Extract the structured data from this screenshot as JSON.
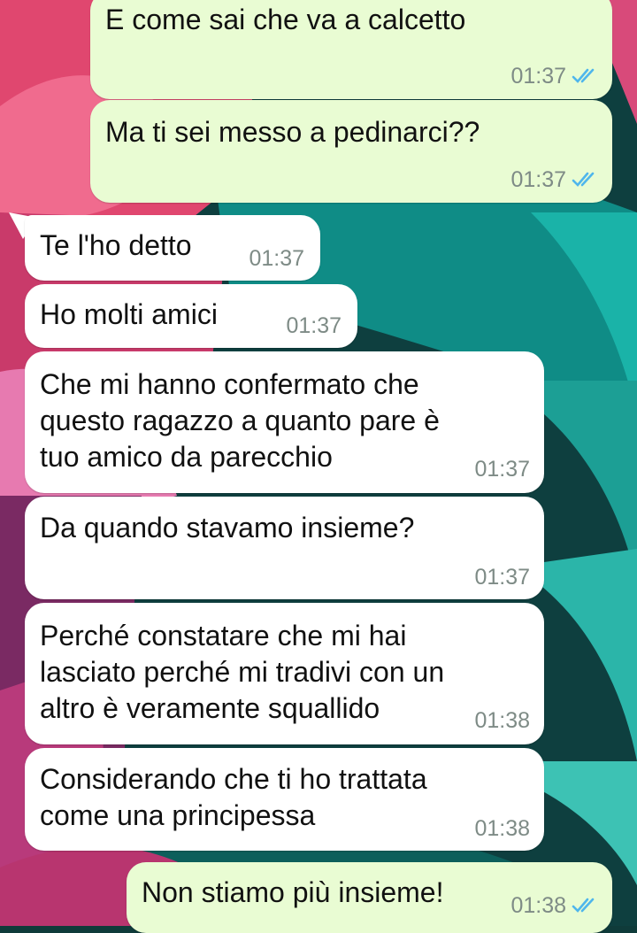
{
  "colors": {
    "outgoing_bubble": "#e9fcd3",
    "incoming_bubble": "#ffffff",
    "timestamp": "#7e8b86",
    "read_ticks": "#4fb6ec"
  },
  "messages": [
    {
      "direction": "outgoing",
      "text": "E come sai che va a calcetto",
      "time": "01:37",
      "status_icon": "double-check-read-icon"
    },
    {
      "direction": "outgoing",
      "text": "Ma ti sei messo a pedinarci??",
      "time": "01:37",
      "status_icon": "double-check-read-icon"
    },
    {
      "direction": "incoming",
      "text": "Te l'ho detto",
      "time": "01:37"
    },
    {
      "direction": "incoming",
      "text": "Ho molti amici",
      "time": "01:37"
    },
    {
      "direction": "incoming",
      "text": "Che mi hanno confermato che\nquesto ragazzo a quanto pare è\ntuo amico da parecchio",
      "time": "01:37"
    },
    {
      "direction": "incoming",
      "text": "Da quando stavamo insieme?",
      "time": "01:37"
    },
    {
      "direction": "incoming",
      "text": "Perché constatare che mi hai\nlasciato perché mi tradivi con un\naltro è veramente squallido",
      "time": "01:38"
    },
    {
      "direction": "incoming",
      "text": "Considerando che ti ho trattata\ncome una principessa",
      "time": "01:38"
    },
    {
      "direction": "outgoing",
      "text": "Non stiamo più insieme!",
      "time": "01:38",
      "status_icon": "double-check-read-icon"
    }
  ]
}
